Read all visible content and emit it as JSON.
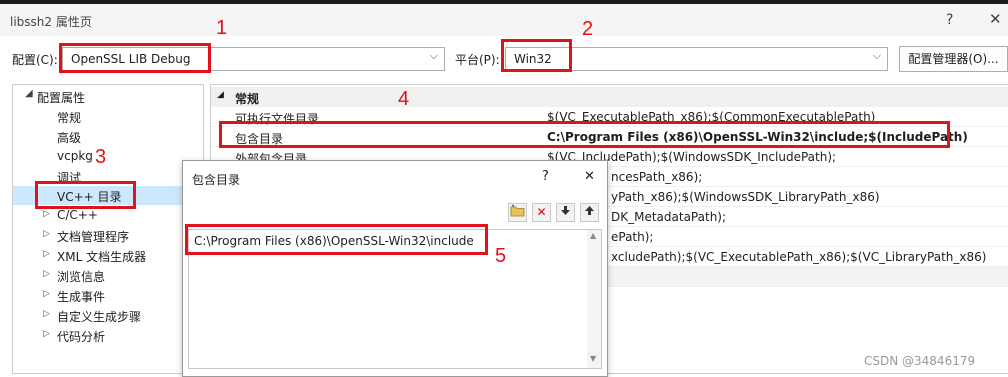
{
  "window": {
    "title": "libssh2 属性页",
    "help": "?",
    "close": "✕"
  },
  "config": {
    "label": "配置(C):",
    "value": "OpenSSL LIB Debug",
    "platform_label": "平台(P):",
    "platform_value": "Win32",
    "manager_button": "配置管理器(O)..."
  },
  "tree": {
    "root": "配置属性",
    "items": [
      "常规",
      "高级",
      "vcpkg",
      "调试",
      "VC++ 目录",
      "C/C++",
      "文档管理程序",
      "XML 文档生成器",
      "浏览信息",
      "生成事件",
      "自定义生成步骤",
      "代码分析"
    ],
    "selected": "VC++ 目录"
  },
  "grid": {
    "section": "常规",
    "rows": [
      {
        "name": "可执行文件目录",
        "value": "$(VC_ExecutablePath_x86);$(CommonExecutablePath)"
      },
      {
        "name": "包含目录",
        "value": "C:\\Program Files (x86)\\OpenSSL-Win32\\include;$(IncludePath)"
      },
      {
        "name": "外部包含目录",
        "value": "$(VC_IncludePath);$(WindowsSDK_IncludePath);"
      },
      {
        "name": "",
        "value": "ncesPath_x86);"
      },
      {
        "name": "",
        "value": "yPath_x86);$(WindowsSDK_LibraryPath_x86)"
      },
      {
        "name": "",
        "value": "DK_MetadataPath);"
      },
      {
        "name": "",
        "value": "ePath);"
      },
      {
        "name": "",
        "value": "xcludePath);$(VC_ExecutablePath_x86);$(VC_LibraryPath_x86)"
      }
    ]
  },
  "dialog": {
    "title": "包含目录",
    "help": "?",
    "close": "✕",
    "entry": "C:\\Program Files (x86)\\OpenSSL-Win32\\include",
    "toolbar": {
      "new": "new-folder-icon",
      "delete": "delete-icon",
      "down": "arrow-down-icon",
      "up": "arrow-up-icon"
    }
  },
  "annotations": [
    "1",
    "2",
    "3",
    "4",
    "5"
  ],
  "watermark": "CSDN @34846179",
  "colors": {
    "annotation_red": "#e0121b",
    "selection_bg": "#cce8ff"
  }
}
